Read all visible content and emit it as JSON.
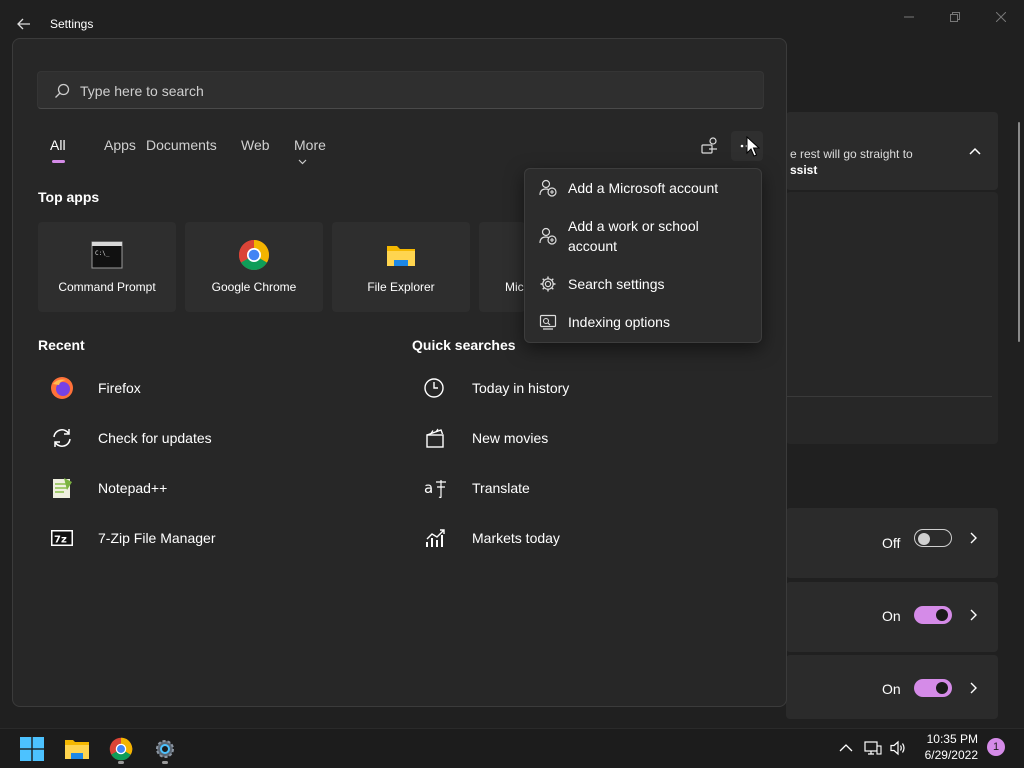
{
  "window": {
    "title": "Settings",
    "snap_text_line1": "e rest will go straight to",
    "snap_text_line2": "ssist",
    "rows": [
      {
        "state": "Off"
      },
      {
        "state": "On"
      },
      {
        "state": "On"
      }
    ]
  },
  "search": {
    "placeholder": "Type here to search",
    "tabs": [
      "All",
      "Apps",
      "Documents",
      "Web",
      "More"
    ],
    "active_tab": "All"
  },
  "top_apps": {
    "title": "Top apps",
    "items": [
      {
        "label": "Command Prompt",
        "icon": "command-prompt-icon"
      },
      {
        "label": "Google Chrome",
        "icon": "chrome-icon"
      },
      {
        "label": "File Explorer",
        "icon": "file-explorer-icon"
      },
      {
        "label": "Mic",
        "icon": "app-icon"
      }
    ]
  },
  "recent": {
    "title": "Recent",
    "items": [
      {
        "label": "Firefox",
        "icon": "firefox-icon"
      },
      {
        "label": "Check for updates",
        "icon": "refresh-icon"
      },
      {
        "label": "Notepad++",
        "icon": "notepad-plus-plus-icon"
      },
      {
        "label": "7-Zip File Manager",
        "icon": "7zip-icon"
      }
    ]
  },
  "quick_searches": {
    "title": "Quick searches",
    "items": [
      {
        "label": "Today in history",
        "icon": "clock-icon"
      },
      {
        "label": "New movies",
        "icon": "clapperboard-icon"
      },
      {
        "label": "Translate",
        "icon": "translate-icon"
      },
      {
        "label": "Markets today",
        "icon": "chart-icon"
      }
    ]
  },
  "context_menu": {
    "items": [
      {
        "label": "Add a Microsoft account",
        "icon": "add-account-icon"
      },
      {
        "label": "Add a work or school account",
        "icon": "add-account-icon"
      },
      {
        "label": "Search settings",
        "icon": "gear-icon"
      },
      {
        "label": "Indexing options",
        "icon": "indexing-icon"
      }
    ]
  },
  "taskbar": {
    "time": "10:35 PM",
    "date": "6/29/2022",
    "notification_count": "1"
  },
  "colors": {
    "accent": "#d58be8",
    "background": "#202020",
    "flyout": "#272727"
  }
}
